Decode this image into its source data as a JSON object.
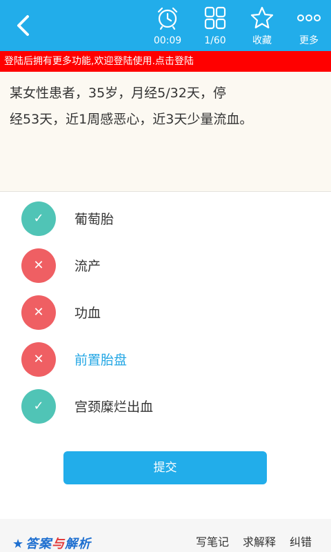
{
  "header": {
    "back_icon": "chevron-left-icon",
    "timer": {
      "icon": "alarm-clock-icon",
      "label": "00:09"
    },
    "progress": {
      "icon": "grid-icon",
      "label": "1/60"
    },
    "favorite": {
      "icon": "star-icon",
      "label": "收藏"
    },
    "more": {
      "icon": "more-dots-icon",
      "label": "更多"
    }
  },
  "notice": {
    "text": "登陆后拥有更多功能,欢迎登陆使用.点击登陆"
  },
  "question": {
    "line1": "某女性患者，35岁，月经5/32天，停",
    "line2": "经53天，近1周感恶心，近3天少量流血。"
  },
  "options": [
    {
      "label": "葡萄胎",
      "mark": "✓",
      "state": "correct"
    },
    {
      "label": "流产",
      "mark": "✕",
      "state": "wrong"
    },
    {
      "label": "功血",
      "mark": "✕",
      "state": "wrong"
    },
    {
      "label": "前置胎盘",
      "mark": "✕",
      "state": "wrong"
    },
    {
      "label": "宫颈糜烂出血",
      "mark": "✓",
      "state": "correct"
    }
  ],
  "submit": {
    "label": "提交"
  },
  "footer": {
    "logo": {
      "star": "★",
      "part1": "答案",
      "mid": "与",
      "part2": "解析"
    },
    "write_note": "写笔记",
    "ask_explain": "求解释",
    "report_error": "纠错"
  },
  "colors": {
    "primary": "#22adea",
    "notice_bg": "#ff0000",
    "correct": "#50c4b6",
    "wrong": "#ef5f63",
    "highlight_text": "#22a6e4"
  }
}
